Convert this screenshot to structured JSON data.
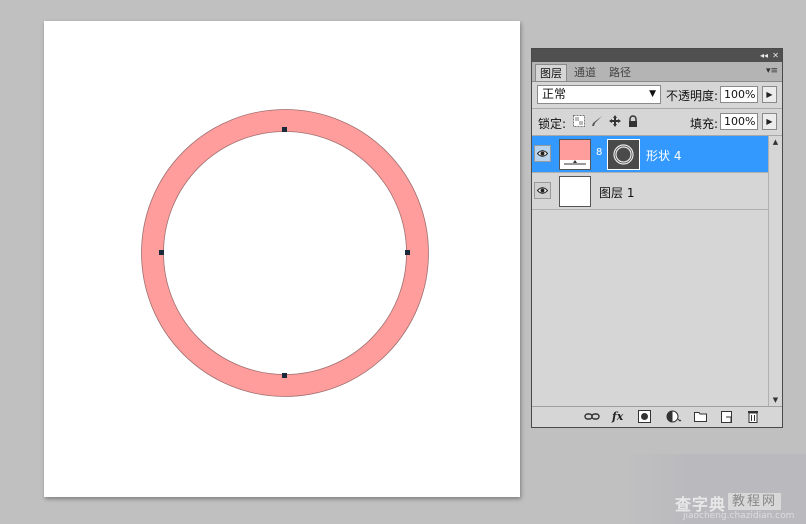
{
  "canvas": {
    "shape_fill": "#ff9c9c",
    "background": "#ffffff"
  },
  "layers_panel": {
    "tabs": [
      {
        "label": "图层",
        "active": true
      },
      {
        "label": "通道",
        "active": false
      },
      {
        "label": "路径",
        "active": false
      }
    ],
    "blend_mode": "正常",
    "opacity_label": "不透明度:",
    "opacity_value": "100%",
    "lock_label": "锁定:",
    "fill_label": "填充:",
    "fill_value": "100%",
    "layers": [
      {
        "name": "形状 4",
        "selected": true,
        "thumb_color": "#ff9c9c",
        "has_vector_mask": true
      },
      {
        "name": "图层 1",
        "selected": false,
        "thumb_color": "#ffffff",
        "has_vector_mask": false
      }
    ],
    "bottom_icons": [
      "link-icon",
      "fx-icon",
      "add-mask-icon",
      "adjustment-icon",
      "new-group-icon",
      "new-layer-icon",
      "trash-icon"
    ],
    "bottom_fx_label": "fx"
  },
  "watermark": {
    "title": "查字典",
    "box": "教程网",
    "url": "jiaocheng.chazidian.com"
  }
}
